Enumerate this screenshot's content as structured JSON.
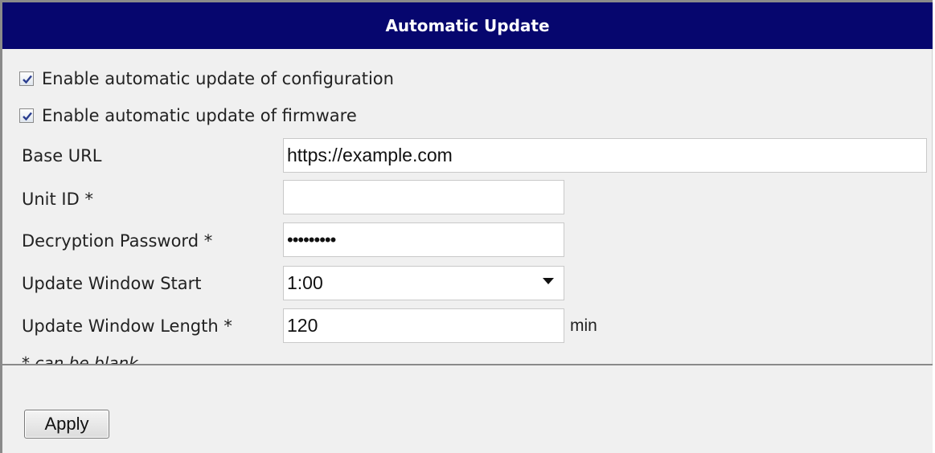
{
  "header": {
    "title": "Automatic Update"
  },
  "options": {
    "config_update": {
      "label": "Enable automatic update of configuration",
      "checked": true
    },
    "firmware_update": {
      "label": "Enable automatic update of firmware",
      "checked": true
    }
  },
  "fields": {
    "base_url": {
      "label": "Base URL",
      "value": "https://example.com"
    },
    "unit_id": {
      "label": "Unit ID *",
      "value": ""
    },
    "decryption_password": {
      "label": "Decryption Password *",
      "value": "•••••••••"
    },
    "window_start": {
      "label": "Update Window Start",
      "value": "1:00"
    },
    "window_length": {
      "label": "Update Window Length *",
      "value": "120",
      "unit": "min"
    }
  },
  "note": "* can be blank",
  "actions": {
    "apply_label": "Apply"
  },
  "colors": {
    "header_bg": "#06066e",
    "panel_bg": "#f0f0f0",
    "border": "#8a8a8a"
  }
}
